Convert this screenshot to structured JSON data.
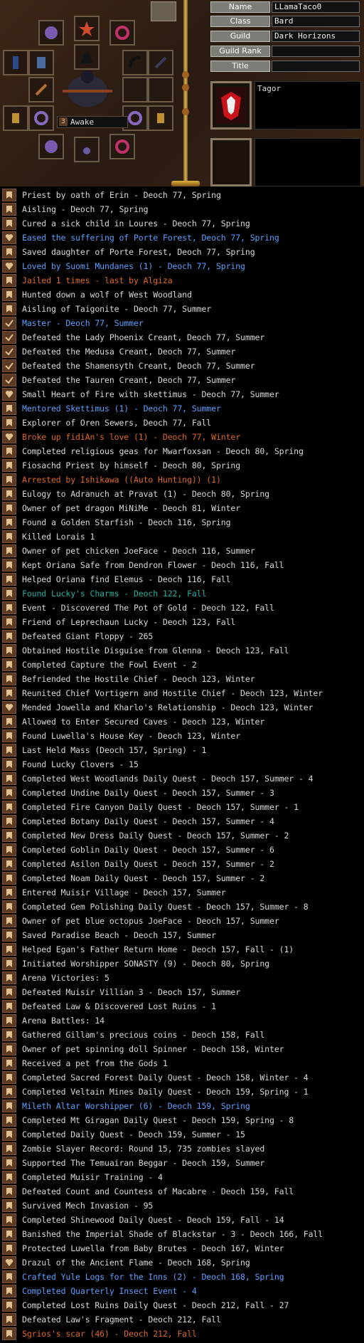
{
  "status": {
    "level_icon": "3",
    "state": "Awake"
  },
  "profile": {
    "fields": [
      {
        "label": "Name",
        "value": "LLamaTaco0"
      },
      {
        "label": "Class",
        "value": "Bard"
      },
      {
        "label": "Guild",
        "value": "Dark Horizons"
      },
      {
        "label": "Guild Rank",
        "value": ""
      },
      {
        "label": "Title",
        "value": ""
      }
    ],
    "legend_text": "Tagor"
  },
  "colors": {
    "normal": "#d8d8d8",
    "blue": "#5aa0ff",
    "orange": "#e06820",
    "teal": "#20b0a0"
  },
  "legend_marks": [
    {
      "text": "Priest by oath of Erin - Deoch 77, Spring",
      "icon": "banner-icon",
      "color": "normal"
    },
    {
      "text": "Aisling - Deoch 77, Spring",
      "icon": "banner-icon",
      "color": "normal"
    },
    {
      "text": "Cured a sick child in Loures - Deoch 77, Spring",
      "icon": "banner-icon",
      "color": "normal"
    },
    {
      "text": "Eased the suffering of Porte Forest, Deoch 77, Spring",
      "icon": "heart-icon",
      "color": "blue"
    },
    {
      "text": "Saved daughter of Porte Forest, Deoch 77, Spring",
      "icon": "banner-icon",
      "color": "normal"
    },
    {
      "text": "Loved by Suomi Mundanes (1) - Deoch 77, Spring",
      "icon": "heart-icon",
      "color": "blue"
    },
    {
      "text": "Jailed 1 times - last by Algiza",
      "icon": "banner-icon",
      "color": "orange"
    },
    {
      "text": "Hunted down a wolf of West Woodland",
      "icon": "banner-icon",
      "color": "normal"
    },
    {
      "text": "Aisling of Taigonite - Deoch 77, Summer",
      "icon": "banner-icon",
      "color": "normal"
    },
    {
      "text": "Master - Deoch 77, Summer",
      "icon": "check-icon",
      "color": "blue"
    },
    {
      "text": "Defeated the Lady Phoenix Creant, Deoch 77, Summer",
      "icon": "check-icon",
      "color": "normal"
    },
    {
      "text": "Defeated the Medusa Creant, Deoch 77, Summer",
      "icon": "check-icon",
      "color": "normal"
    },
    {
      "text": "Defeated the Shamensyth Creant, Deoch 77, Summer",
      "icon": "check-icon",
      "color": "normal"
    },
    {
      "text": "Defeated the Tauren Creant, Deoch 77, Summer",
      "icon": "check-icon",
      "color": "normal"
    },
    {
      "text": "Small Heart of Fire with skettimus - Deoch 77, Summer",
      "icon": "heart-icon",
      "color": "normal"
    },
    {
      "text": "Mentored Skettimus (1) - Deoch 77, Summer",
      "icon": "banner-icon",
      "color": "blue"
    },
    {
      "text": "Explorer of Oren Sewers, Deoch 77, Fall",
      "icon": "banner-icon",
      "color": "normal"
    },
    {
      "text": "Broke up fidiAn's love (1) - Deoch 77, Winter",
      "icon": "heart-icon",
      "color": "orange"
    },
    {
      "text": "Completed religious geas for Mwarfoxsan - Deoch 80, Spring",
      "icon": "banner-icon",
      "color": "normal"
    },
    {
      "text": "Fiosachd Priest by himself - Deoch 80, Spring",
      "icon": "banner-icon",
      "color": "normal"
    },
    {
      "text": "Arrested by Ishikawa ((Auto Hunting)) (1)",
      "icon": "banner-icon",
      "color": "orange"
    },
    {
      "text": "Eulogy to Adranuch at Pravat (1) - Deoch 80, Spring",
      "icon": "banner-icon",
      "color": "normal"
    },
    {
      "text": "Owner of pet dragon MiNiMe - Deoch 81, Winter",
      "icon": "banner-icon",
      "color": "normal"
    },
    {
      "text": "Found a Golden Starfish - Deoch 116, Spring",
      "icon": "banner-icon",
      "color": "normal"
    },
    {
      "text": "Killed Lorais 1",
      "icon": "banner-icon",
      "color": "normal"
    },
    {
      "text": "Owner of pet chicken JoeFace - Deoch 116, Summer",
      "icon": "banner-icon",
      "color": "normal"
    },
    {
      "text": "Kept Oriana Safe from Dendron Flower - Deoch 116, Fall",
      "icon": "banner-icon",
      "color": "normal"
    },
    {
      "text": "Helped Oriana find Elemus - Deoch 116, Fall",
      "icon": "banner-icon",
      "color": "normal"
    },
    {
      "text": "Found Lucky's Charms - Deoch 122, Fall",
      "icon": "banner-icon",
      "color": "teal"
    },
    {
      "text": "Event - Discovered The Pot of Gold - Deoch 122, Fall",
      "icon": "banner-icon",
      "color": "normal"
    },
    {
      "text": "Friend of Leprechaun Lucky - Deoch 123, Fall",
      "icon": "banner-icon",
      "color": "normal"
    },
    {
      "text": "Defeated Giant Floppy - 265",
      "icon": "banner-icon",
      "color": "normal"
    },
    {
      "text": "Obtained Hostile Disguise from Glenna - Deoch 123, Fall",
      "icon": "banner-icon",
      "color": "normal"
    },
    {
      "text": "Completed Capture the Fowl Event - 2",
      "icon": "banner-icon",
      "color": "normal"
    },
    {
      "text": "Befriended the Hostile Chief - Deoch 123, Winter",
      "icon": "banner-icon",
      "color": "normal"
    },
    {
      "text": "Reunited Chief Vortigern and Hostile Chief - Deoch 123, Winter",
      "icon": "banner-icon",
      "color": "normal"
    },
    {
      "text": "Mended Jowella and Kharlo's Relationship - Deoch 123, Winter",
      "icon": "heart-icon",
      "color": "normal"
    },
    {
      "text": "Allowed to Enter Secured Caves - Deoch 123, Winter",
      "icon": "banner-icon",
      "color": "normal"
    },
    {
      "text": "Found Luwella's House Key - Deoch 123, Winter",
      "icon": "banner-icon",
      "color": "normal"
    },
    {
      "text": "Last Held Mass (Deoch 157, Spring) - 1",
      "icon": "banner-icon",
      "color": "normal"
    },
    {
      "text": "Found Lucky Clovers - 15",
      "icon": "banner-icon",
      "color": "normal"
    },
    {
      "text": "Completed West Woodlands Daily Quest - Deoch 157, Summer - 4",
      "icon": "banner-icon",
      "color": "normal"
    },
    {
      "text": "Completed Undine Daily Quest - Deoch 157, Summer - 3",
      "icon": "banner-icon",
      "color": "normal"
    },
    {
      "text": "Completed Fire Canyon Daily Quest - Deoch 157, Summer - 1",
      "icon": "banner-icon",
      "color": "normal"
    },
    {
      "text": "Completed Botany Daily Quest - Deoch 157, Summer - 4",
      "icon": "banner-icon",
      "color": "normal"
    },
    {
      "text": "Completed New Dress Daily Quest - Deoch 157, Summer - 2",
      "icon": "banner-icon",
      "color": "normal"
    },
    {
      "text": "Completed Goblin Daily Quest - Deoch 157, Summer - 6",
      "icon": "banner-icon",
      "color": "normal"
    },
    {
      "text": "Completed Asilon Daily Quest - Deoch 157, Summer - 2",
      "icon": "banner-icon",
      "color": "normal"
    },
    {
      "text": "Completed Noam Daily Quest - Deoch 157, Summer - 2",
      "icon": "banner-icon",
      "color": "normal"
    },
    {
      "text": "Entered Muisir Village - Deoch 157, Summer",
      "icon": "banner-icon",
      "color": "normal"
    },
    {
      "text": "Completed Gem Polishing Daily Quest - Deoch 157, Summer - 8",
      "icon": "banner-icon",
      "color": "normal"
    },
    {
      "text": "Owner of pet blue octopus JoeFace - Deoch 157, Summer",
      "icon": "banner-icon",
      "color": "normal"
    },
    {
      "text": "Saved Paradise Beach - Deoch 157, Summer",
      "icon": "banner-icon",
      "color": "normal"
    },
    {
      "text": "Helped Egan's Father Return Home - Deoch 157, Fall - (1)",
      "icon": "banner-icon",
      "color": "normal"
    },
    {
      "text": "Initiated Worshipper SONASTY (9) - Deoch 80, Spring",
      "icon": "banner-icon",
      "color": "normal"
    },
    {
      "text": "Arena Victories: 5",
      "icon": "banner-icon",
      "color": "normal"
    },
    {
      "text": "Defeated Muisir Villian 3 - Deoch 157, Summer",
      "icon": "banner-icon",
      "color": "normal"
    },
    {
      "text": "Defeated Law & Discovered Lost Ruins - 1",
      "icon": "banner-icon",
      "color": "normal"
    },
    {
      "text": "Arena Battles: 14",
      "icon": "banner-icon",
      "color": "normal"
    },
    {
      "text": "Gathered Gillam's precious coins - Deoch 158, Fall",
      "icon": "banner-icon",
      "color": "normal"
    },
    {
      "text": "Owner of pet spinning doll Spinner - Deoch 158, Winter",
      "icon": "banner-icon",
      "color": "normal"
    },
    {
      "text": "Received a pet from the Gods 1",
      "icon": "banner-icon",
      "color": "normal"
    },
    {
      "text": "Completed Sacred Forest Daily Quest - Deoch 158, Winter - 4",
      "icon": "banner-icon",
      "color": "normal"
    },
    {
      "text": "Completed Veltain Mines Daily Quest - Deoch 159, Spring - 1",
      "icon": "banner-icon",
      "color": "normal"
    },
    {
      "text": "Mileth Altar Worshipper (6) - Deoch 159, Spring",
      "icon": "banner-icon",
      "color": "blue"
    },
    {
      "text": "Completed Mt Giragan Daily Quest - Deoch 159, Spring - 8",
      "icon": "banner-icon",
      "color": "normal"
    },
    {
      "text": "Completed Daily Quest - Deoch 159, Summer - 15",
      "icon": "banner-icon",
      "color": "normal"
    },
    {
      "text": "Zombie Slayer Record: Round 15, 735 zombies slayed",
      "icon": "banner-icon",
      "color": "normal"
    },
    {
      "text": "Supported The Temuairan Beggar - Deoch 159, Summer",
      "icon": "banner-icon",
      "color": "normal"
    },
    {
      "text": "Completed Muisir Training - 4",
      "icon": "banner-icon",
      "color": "normal"
    },
    {
      "text": "Defeated Count and Countess of Macabre - Deoch 159, Fall",
      "icon": "banner-icon",
      "color": "normal"
    },
    {
      "text": "Survived Mech Invasion - 95",
      "icon": "banner-icon",
      "color": "normal"
    },
    {
      "text": "Completed Shinewood Daily Quest - Deoch 159, Fall - 14",
      "icon": "banner-icon",
      "color": "normal"
    },
    {
      "text": "Banished the Imperial Shade of Blackstar - 3 - Deoch 166, Fall",
      "icon": "banner-icon",
      "color": "normal"
    },
    {
      "text": "Protected Luwella from Baby Brutes - Deoch 167, Winter",
      "icon": "banner-icon",
      "color": "normal"
    },
    {
      "text": "Drazul of the Ancient Flame - Deoch 168, Spring",
      "icon": "heart-icon",
      "color": "normal"
    },
    {
      "text": "Crafted Yule Logs for the Inns (2) - Deoch 168, Spring",
      "icon": "banner-icon",
      "color": "blue"
    },
    {
      "text": "Completed Quarterly Insect Event - 4",
      "icon": "banner-icon",
      "color": "blue"
    },
    {
      "text": "Completed Lost Ruins Daily Quest - Deoch 212, Fall - 27",
      "icon": "banner-icon",
      "color": "normal"
    },
    {
      "text": "Defeated Law's Fragment - Deoch 212, Fall",
      "icon": "banner-icon",
      "color": "normal"
    },
    {
      "text": "Sgrios's scar (46) - Deoch 212, Fall",
      "icon": "banner-icon",
      "color": "orange"
    }
  ]
}
